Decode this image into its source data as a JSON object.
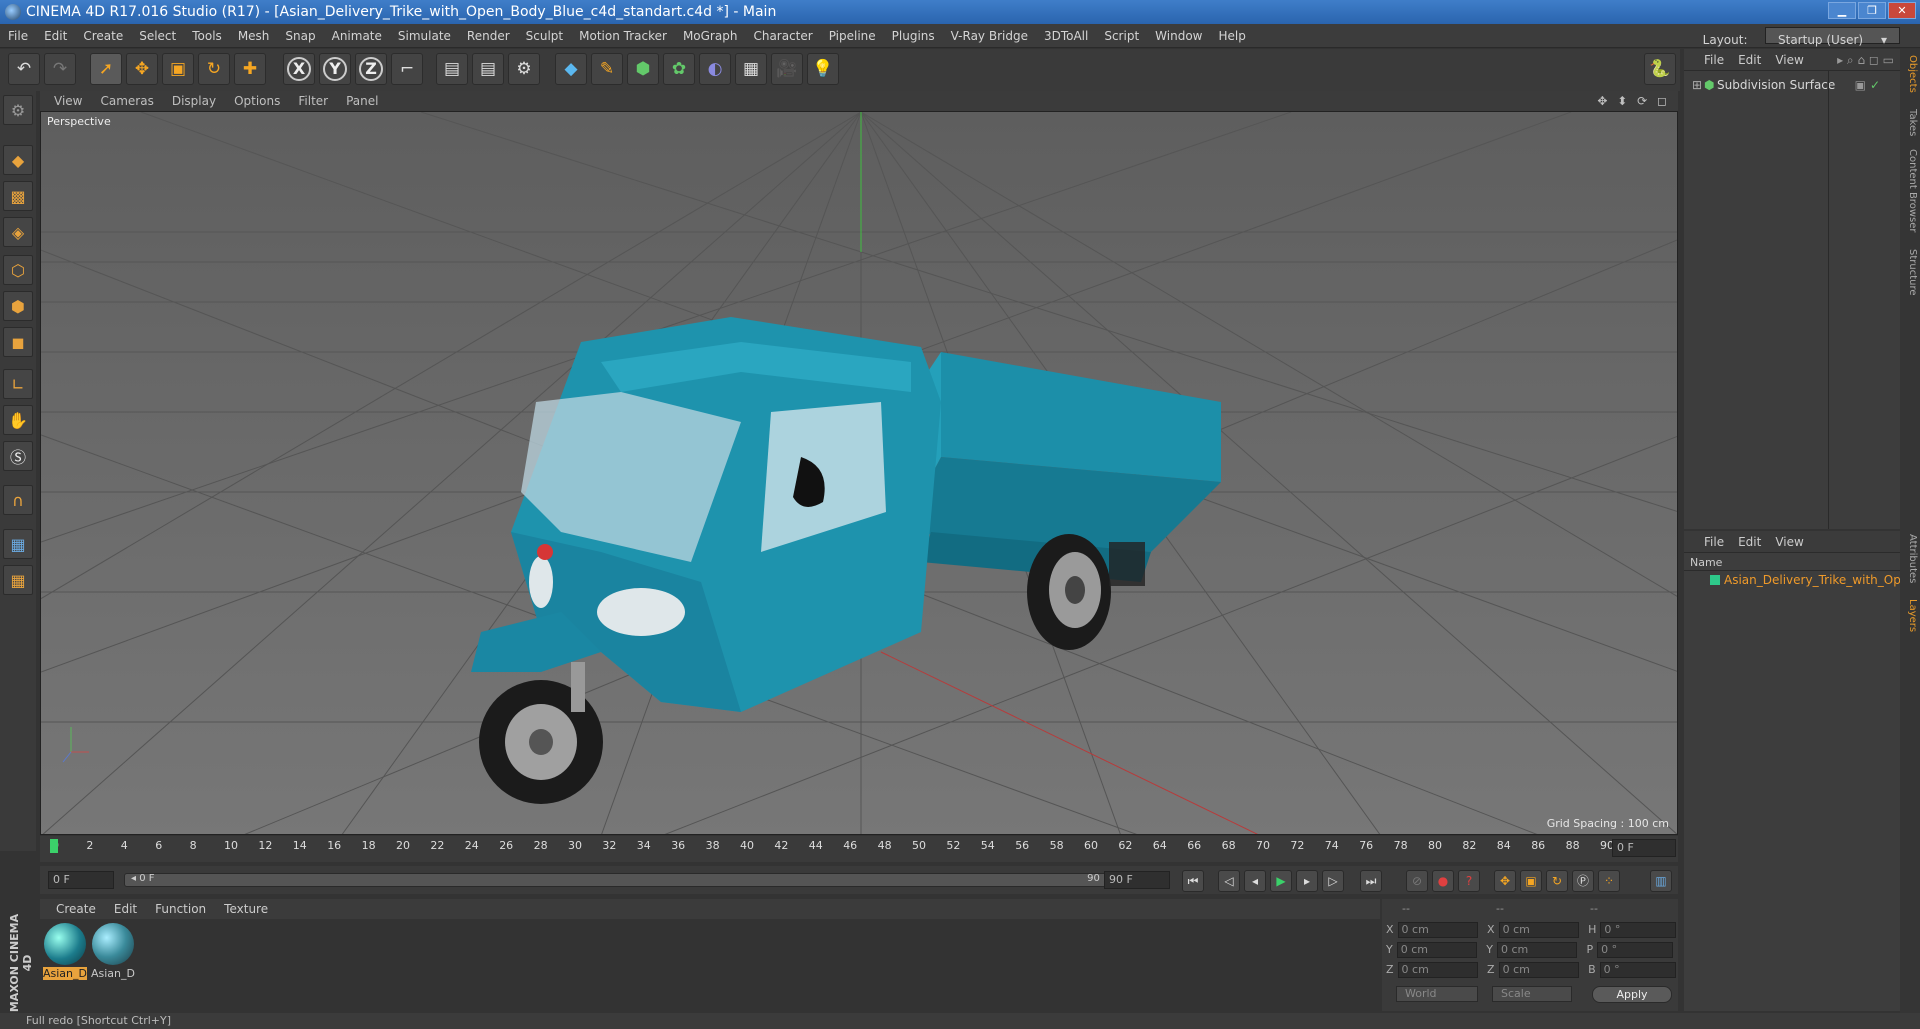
{
  "window": {
    "title": "CINEMA 4D R17.016 Studio (R17) - [Asian_Delivery_Trike_with_Open_Body_Blue_c4d_standart.c4d *] - Main",
    "controls": [
      "▁",
      "❐",
      "✕"
    ]
  },
  "menu": [
    "File",
    "Edit",
    "Create",
    "Select",
    "Tools",
    "Mesh",
    "Snap",
    "Animate",
    "Simulate",
    "Render",
    "Sculpt",
    "Motion Tracker",
    "MoGraph",
    "Character",
    "Pipeline",
    "Plugins",
    "V-Ray Bridge",
    "3DToAll",
    "Script",
    "Window",
    "Help"
  ],
  "layout": {
    "label": "Layout:",
    "value": "Startup (User)"
  },
  "toolbar": {
    "undo": "↶",
    "redo": "↷",
    "select": "➚",
    "move": "✥",
    "scale": "▣",
    "rotate": "↻",
    "last": "✚",
    "x": "X",
    "y": "Y",
    "z": "Z",
    "coord": "⌐",
    "render_view": "▤",
    "render": "▤",
    "render_settings": "⚙",
    "cube": "◆",
    "pen": "✎",
    "generator": "⬢",
    "deformer": "✿",
    "scene": "◐",
    "floor": "▦",
    "camera": "🎥",
    "light": "💡",
    "python": "🐍"
  },
  "viewport": {
    "menu": [
      "View",
      "Cameras",
      "Display",
      "Options",
      "Filter",
      "Panel"
    ],
    "label": "Perspective",
    "grid_spacing": "Grid Spacing : 100 cm",
    "nav_icons": "✥ ⬍ ⟳ ◻"
  },
  "timeline": {
    "ticks": [
      "0",
      "2",
      "4",
      "6",
      "8",
      "10",
      "12",
      "14",
      "16",
      "18",
      "20",
      "22",
      "24",
      "26",
      "28",
      "30",
      "32",
      "34",
      "36",
      "38",
      "40",
      "42",
      "44",
      "46",
      "48",
      "50",
      "52",
      "54",
      "56",
      "58",
      "60",
      "62",
      "64",
      "66",
      "68",
      "70",
      "72",
      "74",
      "76",
      "78",
      "80",
      "82",
      "84",
      "86",
      "88",
      "90"
    ],
    "current": "0 F"
  },
  "playback": {
    "start": "0 F",
    "range_left": "◂ 0 F",
    "range_right": "90 F ▸",
    "end": "90 F",
    "buttons": [
      "⏮",
      "◁",
      "◂",
      "▶",
      "▸",
      "▷",
      "⏭"
    ]
  },
  "materials": {
    "menu": [
      "Create",
      "Edit",
      "Function",
      "Texture"
    ],
    "items": [
      {
        "label": "Asian_D"
      },
      {
        "label": "Asian_D"
      }
    ]
  },
  "coordinates": {
    "headers": [
      "--",
      "--",
      "--"
    ],
    "rows": [
      {
        "a": "X",
        "av": "0 cm",
        "b": "X",
        "bv": "0 cm",
        "c": "H",
        "cv": "0 °"
      },
      {
        "a": "Y",
        "av": "0 cm",
        "b": "Y",
        "bv": "0 cm",
        "c": "P",
        "cv": "0 °"
      },
      {
        "a": "Z",
        "av": "0 cm",
        "b": "Z",
        "bv": "0 cm",
        "c": "B",
        "cv": "0 °"
      }
    ],
    "world": "World",
    "scale": "Scale",
    "apply": "Apply"
  },
  "objects": {
    "menu": [
      "File",
      "Edit",
      "View"
    ],
    "items": [
      {
        "label": "Subdivision Surface"
      }
    ]
  },
  "layers": {
    "menu": [
      "File",
      "Edit",
      "View"
    ],
    "header": "Name",
    "items": [
      {
        "label": "Asian_Delivery_Trike_with_Open_Body_Blue"
      }
    ]
  },
  "right_tabs": [
    "Objects",
    "Takes",
    "Content Browser",
    "Structure",
    "Attributes",
    "Layers"
  ],
  "branding": "MAXON CINEMA 4D",
  "status": "Full redo [Shortcut Ctrl+Y]",
  "colors": {
    "accent": "#f5a623",
    "trike_body": "#1d8aa6",
    "viewport_bg": "#6e6e6e",
    "layer_text": "#ef9a2a"
  }
}
